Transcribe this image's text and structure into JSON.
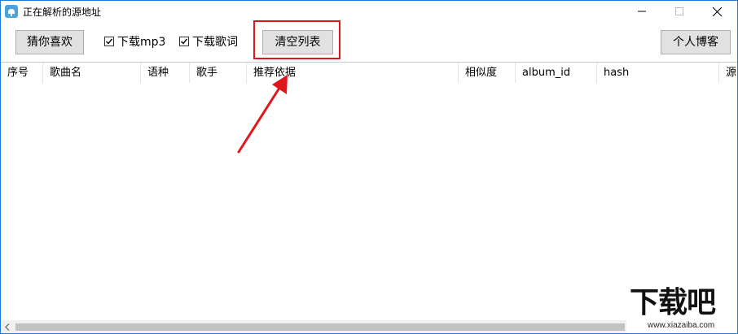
{
  "window": {
    "title": "正在解析的源地址"
  },
  "toolbar": {
    "guess_label": "猜你喜欢",
    "download_mp3_label": "下载mp3",
    "download_mp3_checked": true,
    "download_lyrics_label": "下载歌词",
    "download_lyrics_checked": true,
    "clear_list_label": "清空列表",
    "blog_label": "个人博客"
  },
  "table": {
    "columns": [
      "序号",
      "歌曲名",
      "语种",
      "歌手",
      "推荐依据",
      "相似度",
      "album_id",
      "hash",
      "源"
    ],
    "rows": []
  },
  "colors": {
    "highlight": "#e0161c",
    "window_border": "#1f7bd6",
    "button_bg": "#e1e1e1"
  },
  "icons": {
    "app": "cloud-music-icon",
    "minimize": "minimize-icon",
    "maximize": "maximize-icon",
    "close": "close-icon"
  },
  "watermark": {
    "text": "下载吧",
    "url": "www.xiazaiba.com"
  }
}
